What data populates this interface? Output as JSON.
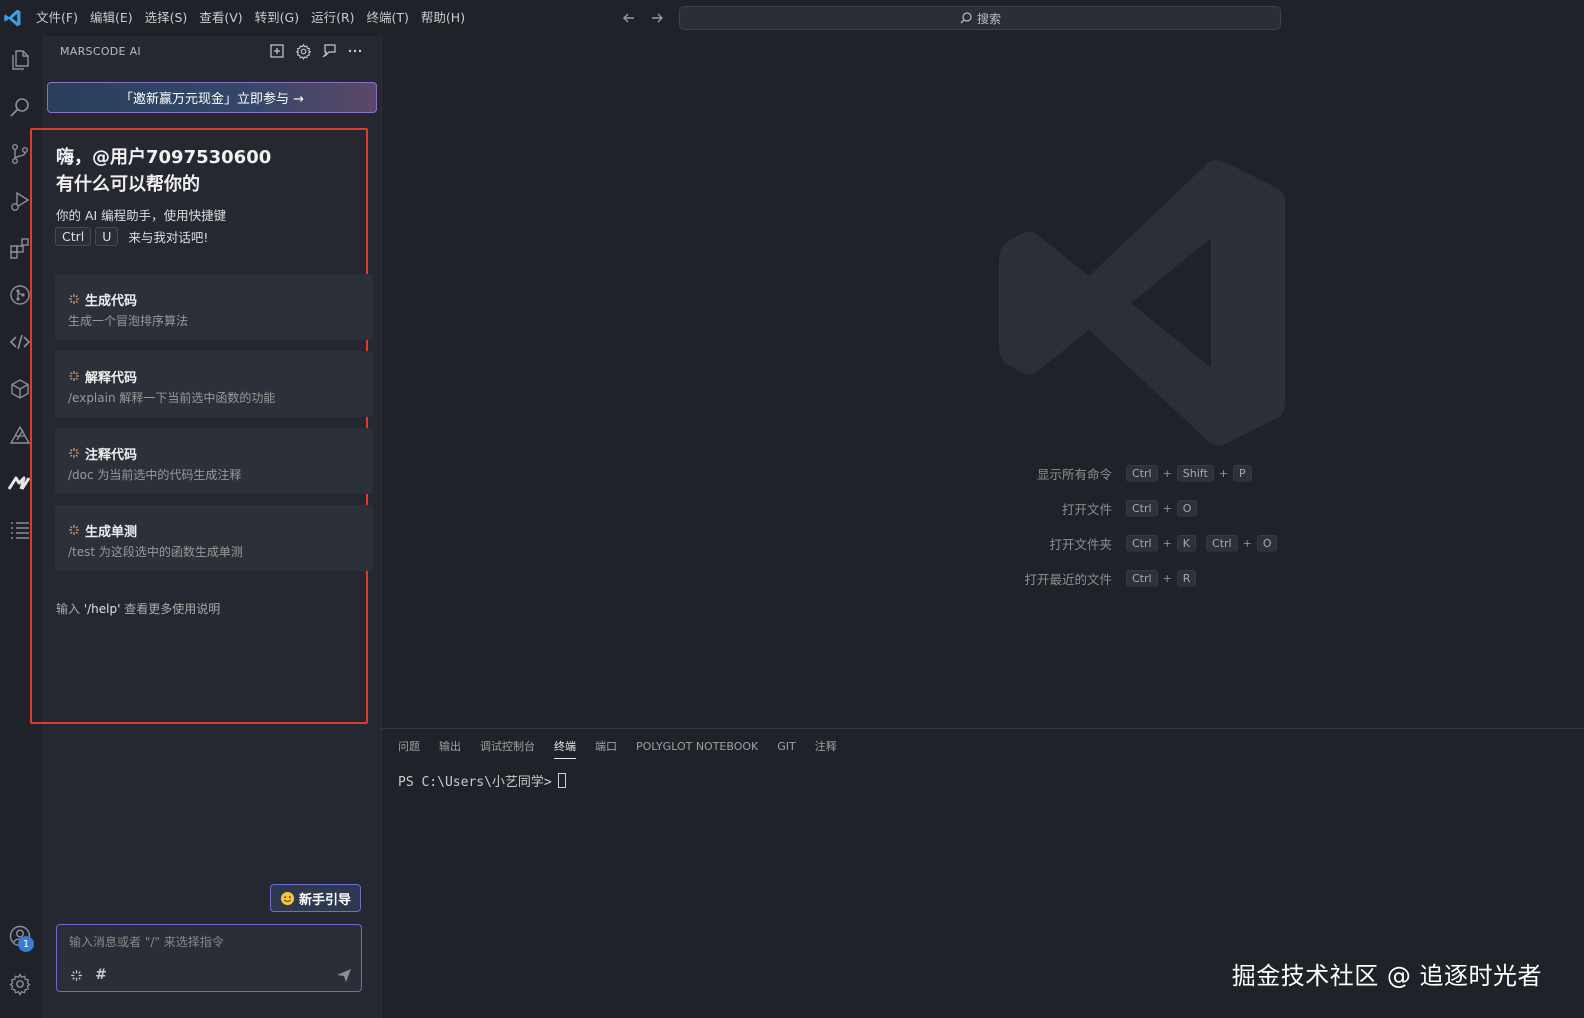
{
  "titlebar": {
    "menus": [
      "文件(F)",
      "编辑(E)",
      "选择(S)",
      "查看(V)",
      "转到(G)",
      "运行(R)",
      "终端(T)",
      "帮助(H)"
    ],
    "search_label": "搜索"
  },
  "sidebar": {
    "header": "MARSCODE AI",
    "promo_banner": "「邀新赢万元现金」立即参与 →",
    "greeting_line1": "嗨，@用户7097530600",
    "greeting_line2": "有什么可以帮你的",
    "desc": "你的 AI 编程助手，使用快捷键",
    "kbd1": "Ctrl",
    "kbd2": "U",
    "kbd_suffix": "来与我对话吧!",
    "cards": [
      {
        "title": "生成代码",
        "subtitle": "生成一个冒泡排序算法"
      },
      {
        "title": "解释代码",
        "subtitle": "/explain 解释一下当前选中函数的功能"
      },
      {
        "title": "注释代码",
        "subtitle": "/doc 为当前选中的代码生成注释"
      },
      {
        "title": "生成单测",
        "subtitle": "/test 为这段选中的函数生成单测"
      }
    ],
    "help_prefix": "输入",
    "help_cmd": "'/help'",
    "help_suffix": "查看更多使用说明",
    "guide_button": "新手引导",
    "input_placeholder": "输入消息或者 \"/\" 来选择指令",
    "hash_symbol": "#"
  },
  "activity": {
    "accounts_badge": "1"
  },
  "editor": {
    "shortcuts": [
      {
        "label": "显示所有命令",
        "keys": [
          "Ctrl",
          "Shift",
          "P"
        ]
      },
      {
        "label": "打开文件",
        "keys": [
          "Ctrl",
          "O"
        ]
      },
      {
        "label": "打开文件夹",
        "keys": [
          "Ctrl",
          "K"
        ],
        "keys2": [
          "Ctrl",
          "O"
        ]
      },
      {
        "label": "打开最近的文件",
        "keys": [
          "Ctrl",
          "R"
        ]
      }
    ]
  },
  "panel": {
    "tabs": [
      "问题",
      "输出",
      "调试控制台",
      "终端",
      "端口",
      "POLYGLOT NOTEBOOK",
      "GIT",
      "注释"
    ],
    "active_tab": "终端",
    "terminal_prompt": "PS C:\\Users\\小艺同学>"
  },
  "watermark": "掘金技术社区 @ 追逐时光者",
  "colors": {
    "accent": "#3a7bd5",
    "highlight_border": "#e03a2f",
    "input_border": "#7c63c9"
  }
}
